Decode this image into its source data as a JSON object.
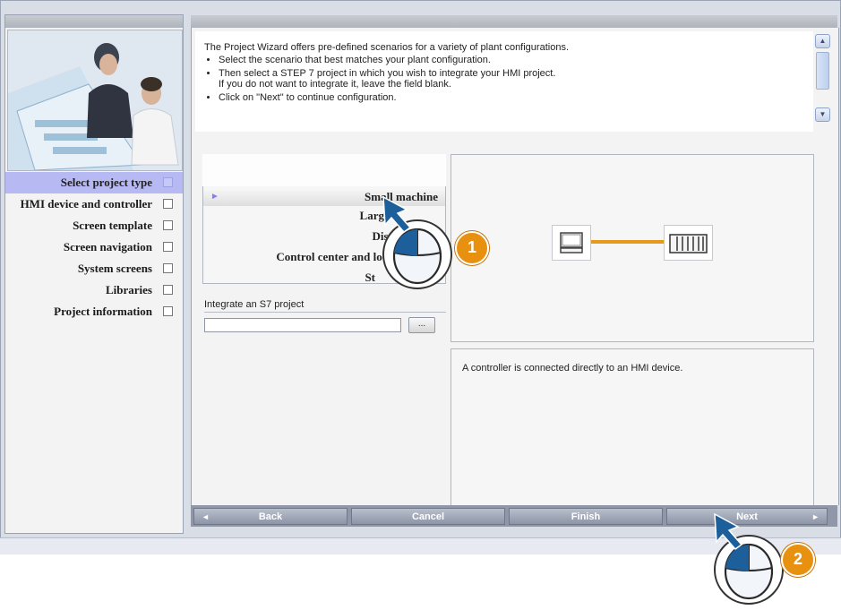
{
  "intro": {
    "lead": "The Project Wizard offers pre-defined scenarios for a variety of plant configurations.",
    "bullets": [
      "Select the scenario that best matches your plant configuration.",
      "Then select a STEP 7 project in which you wish to integrate your HMI project.",
      "Click on \"Next\" to continue configuration."
    ],
    "bullet2_line2": "If you do not want to integrate it, leave the field blank."
  },
  "steps": [
    {
      "label": "Select project type",
      "active": true
    },
    {
      "label": "HMI device and controller",
      "active": false
    },
    {
      "label": "Screen template",
      "active": false
    },
    {
      "label": "Screen navigation",
      "active": false
    },
    {
      "label": "System screens",
      "active": false
    },
    {
      "label": "Libraries",
      "active": false
    },
    {
      "label": "Project information",
      "active": false
    }
  ],
  "scenarios": {
    "selected_marker": "►",
    "items": [
      "Small machine",
      "Large machine",
      "Distributed",
      "Control center and local",
      "Standalone"
    ],
    "visible": [
      "Small machine",
      "Larg",
      "Distributed",
      "Control center and loca",
      "St"
    ]
  },
  "s7": {
    "label": "Integrate an S7 project",
    "value": "",
    "browse": "..."
  },
  "description": "A controller is connected directly to an HMI device.",
  "footer": {
    "back": "Back",
    "cancel": "Cancel",
    "finish": "Finish",
    "next": "Next",
    "left_arrow": "◄",
    "right_arrow": "►"
  },
  "callouts": [
    "1",
    "2"
  ],
  "colors": {
    "active_step": "#b7b9f2",
    "connection": "#e59a1c",
    "badge": "#e8900f",
    "cursor": "#1d5f9a"
  },
  "icons": {
    "hmi": "monitor-icon",
    "plc": "plc-rack-icon",
    "mouse": "mouse-click-icon"
  }
}
